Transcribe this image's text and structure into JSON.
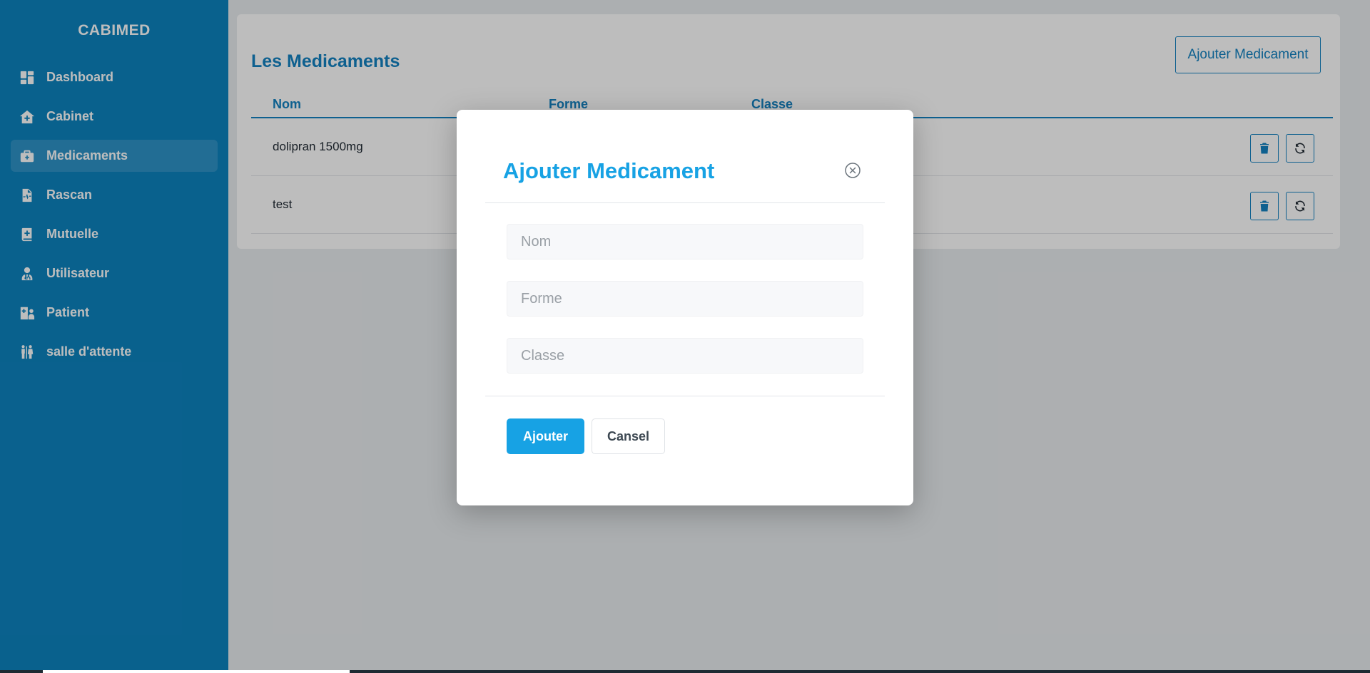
{
  "sidebar": {
    "brand": "CABIMED",
    "items": [
      {
        "label": "Dashboard",
        "icon": "dashboard-icon",
        "active": false
      },
      {
        "label": "Cabinet",
        "icon": "home-medical-icon",
        "active": false
      },
      {
        "label": "Medicaments",
        "icon": "medical-kit-icon",
        "active": true
      },
      {
        "label": "Rascan",
        "icon": "file-waveform-icon",
        "active": false
      },
      {
        "label": "Mutuelle",
        "icon": "book-medical-icon",
        "active": false
      },
      {
        "label": "Utilisateur",
        "icon": "user-doctor-icon",
        "active": false
      },
      {
        "label": "Patient",
        "icon": "hospital-user-icon",
        "active": false
      },
      {
        "label": "salle d'attente",
        "icon": "people-waiting-icon",
        "active": false
      }
    ]
  },
  "main": {
    "title": "Les Medicaments",
    "add_button": "Ajouter Medicament",
    "columns": [
      "Nom",
      "Forme",
      "Classe"
    ],
    "rows": [
      {
        "nom": "dolipran 1500mg"
      },
      {
        "nom": "test"
      }
    ]
  },
  "modal": {
    "title": "Ajouter Medicament",
    "fields": {
      "nom_placeholder": "Nom",
      "forme_placeholder": "Forme",
      "classe_placeholder": "Classe"
    },
    "submit": "Ajouter",
    "cancel": "Cansel"
  },
  "colors": {
    "sidebar": "#0d83bf",
    "accent": "#1382c2",
    "modal_accent": "#17a2e4"
  }
}
